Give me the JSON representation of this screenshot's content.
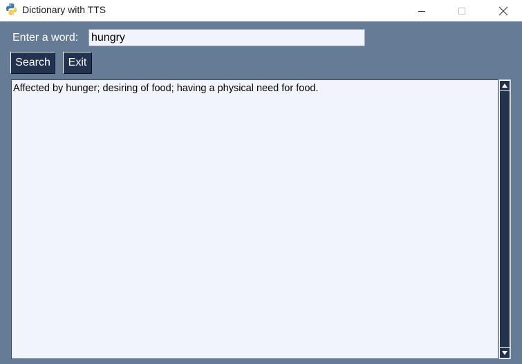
{
  "window": {
    "title": "Dictionary with TTS",
    "icon": "python-icon"
  },
  "form": {
    "word_label": "Enter a word:",
    "word_value": "hungry"
  },
  "buttons": {
    "search_label": "Search",
    "exit_label": "Exit"
  },
  "result": {
    "text": "Affected by hunger; desiring of food; having a physical need for food."
  },
  "colors": {
    "background": "#667c96",
    "button": "#23324f",
    "text_area": "#f1f4fa"
  }
}
